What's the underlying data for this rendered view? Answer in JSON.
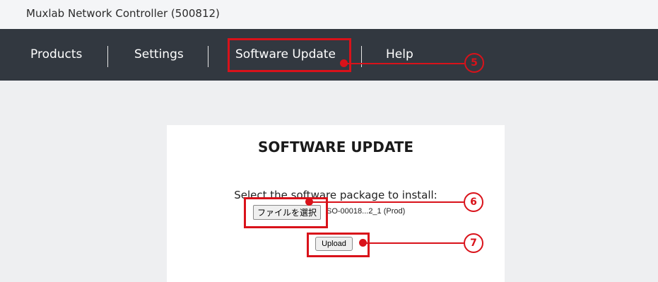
{
  "window": {
    "title": "Muxlab Network Controller (500812)"
  },
  "nav": {
    "items": [
      {
        "label": "Products"
      },
      {
        "label": "Settings"
      },
      {
        "label": "Software Update"
      },
      {
        "label": "Help"
      }
    ]
  },
  "software_update": {
    "title": "SOFTWARE UPDATE",
    "instruction": "Select the software package to install:",
    "file_button_label": "ファイルを選択",
    "file_name": "SO-00018...2_1 (Prod)",
    "upload_label": "Upload"
  },
  "callouts": [
    {
      "number": "5"
    },
    {
      "number": "6"
    },
    {
      "number": "7"
    }
  ],
  "colors": {
    "navbar_bg": "#323840",
    "content_bg": "#eeeff1",
    "highlight_red": "#d9121a"
  }
}
